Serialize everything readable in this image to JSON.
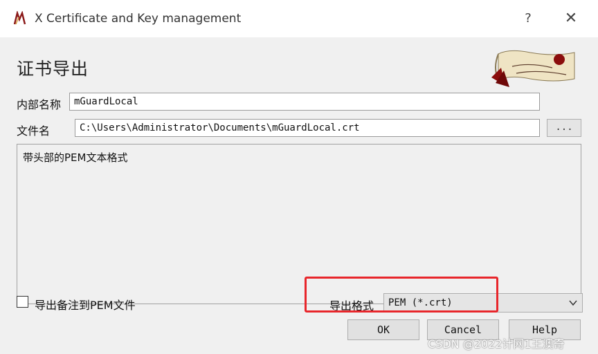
{
  "window": {
    "title": "X Certificate and Key management",
    "help_glyph": "?",
    "close_glyph": "✕",
    "icon": "xca-app-icon"
  },
  "dialog": {
    "heading": "证书导出",
    "logo": "xca-scroll-logo"
  },
  "form": {
    "internal_name_label": "内部名称",
    "internal_name_value": "mGuardLocal",
    "filename_label": "文件名",
    "filename_value": "C:\\Users\\Administrator\\Documents\\mGuardLocal.crt",
    "browse_label": "...",
    "description": "带头部的PEM文本格式",
    "export_comment_label": "导出备注到PEM文件",
    "export_comment_checked": false,
    "format_label": "导出格式",
    "format_value": "PEM (*.crt)"
  },
  "buttons": {
    "ok": "OK",
    "cancel": "Cancel",
    "help": "Help"
  },
  "watermark": "CSDN @2022计网1王澳奇",
  "colors": {
    "highlight": "#e8262b",
    "dialog_bg": "#f0f0f0"
  }
}
